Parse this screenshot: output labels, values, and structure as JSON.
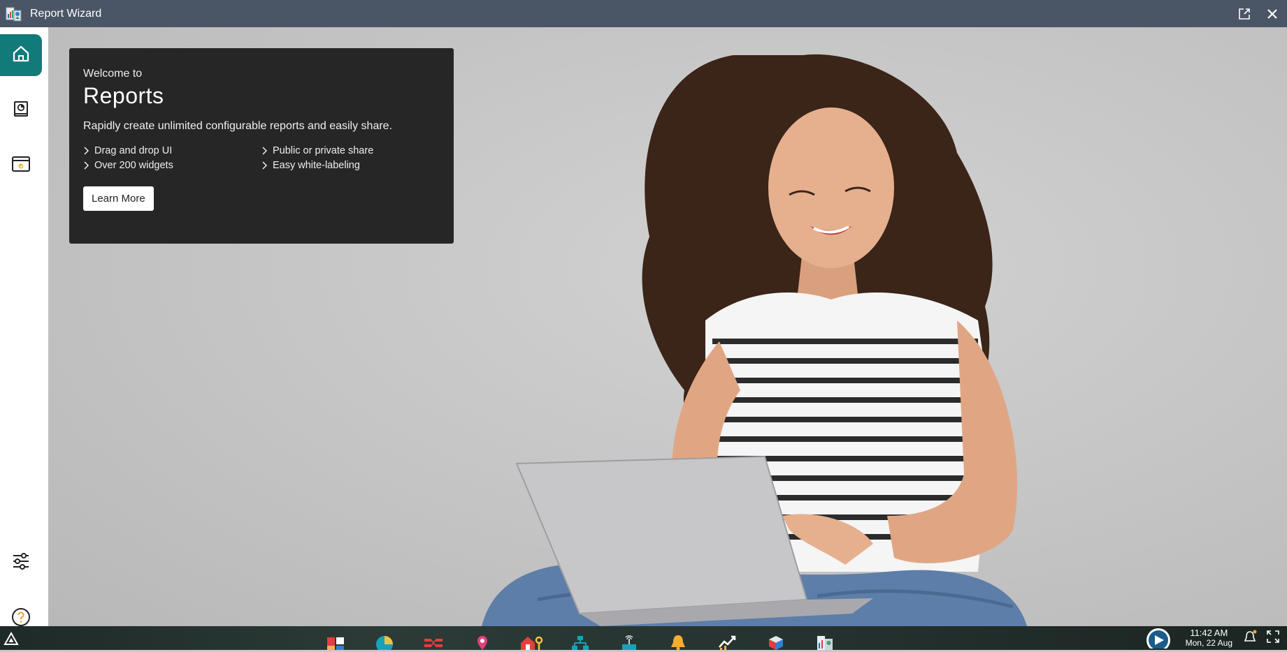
{
  "window": {
    "title": "Report Wizard"
  },
  "sidebar": {
    "items": [
      {
        "name": "home",
        "icon": "home-icon",
        "active": true
      },
      {
        "name": "reports",
        "icon": "report-book-icon",
        "active": false
      },
      {
        "name": "templates",
        "icon": "browser-window-icon",
        "active": false
      }
    ],
    "bottom": [
      {
        "name": "settings",
        "icon": "sliders-icon"
      },
      {
        "name": "help",
        "icon": "help-circle-icon"
      }
    ]
  },
  "welcome": {
    "pre": "Welcome to",
    "heading": "Reports",
    "description": "Rapidly create unlimited configurable reports and easily share.",
    "features": [
      "Drag and drop UI",
      "Public or private share",
      "Over 200 widgets",
      "Easy white-labeling"
    ],
    "cta": "Learn More"
  },
  "taskbar": {
    "apps": [
      "dashboard-app-icon",
      "pie-chart-app-icon",
      "flow-app-icon",
      "map-pin-app-icon",
      "home-key-app-icon",
      "network-app-icon",
      "router-app-icon",
      "bell-app-icon",
      "trend-chart-app-icon",
      "cube-app-icon",
      "report-wizard-app-icon"
    ],
    "time": "11:42 AM",
    "date": "Mon, 22 Aug"
  },
  "colors": {
    "accent": "#137a7a",
    "titlebar": "#4a5565",
    "card": "#262626"
  }
}
